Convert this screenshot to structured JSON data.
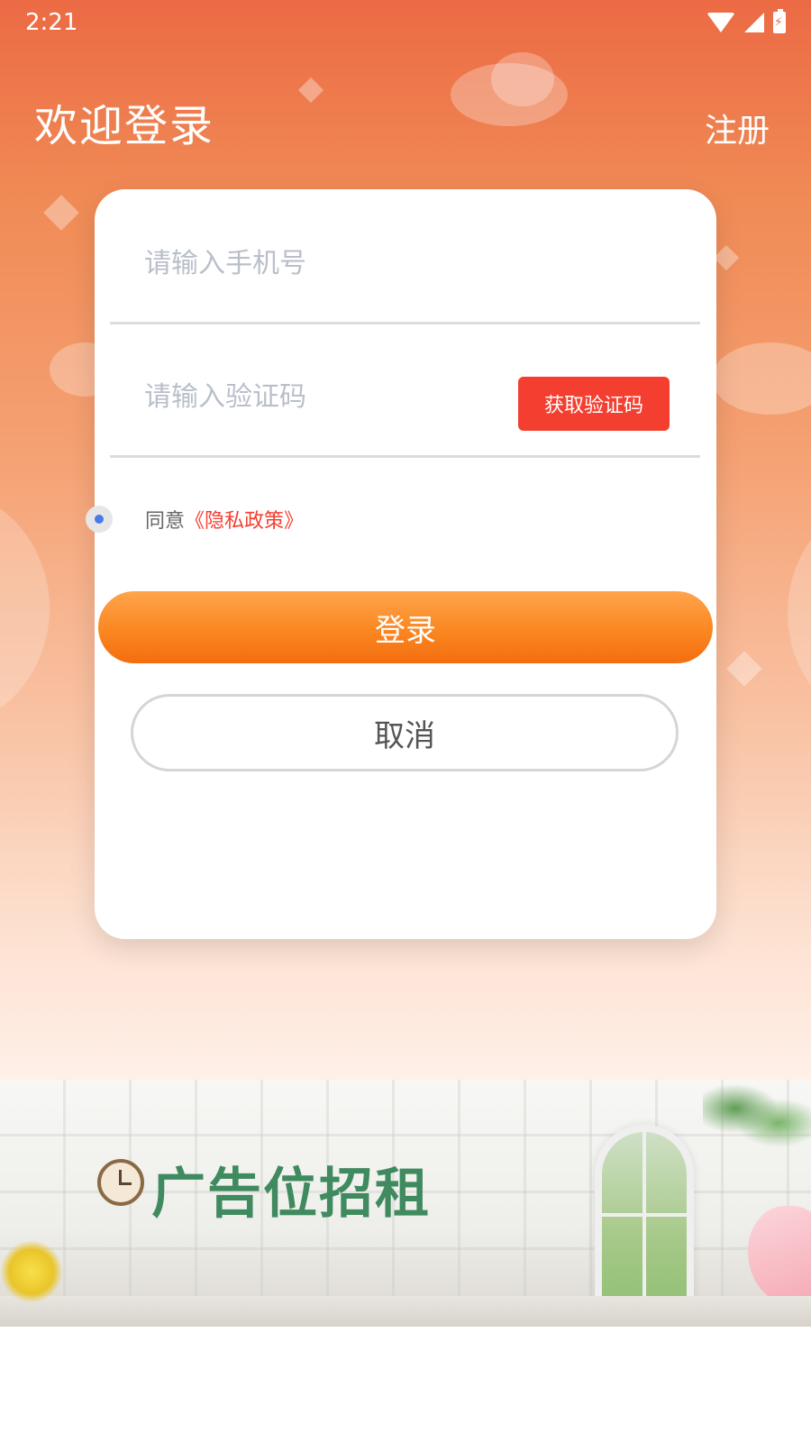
{
  "status_bar": {
    "time": "2:21"
  },
  "header": {
    "title": "欢迎登录",
    "register_label": "注册"
  },
  "form": {
    "phone_placeholder": "请输入手机号",
    "code_placeholder": "请输入验证码",
    "get_code_label": "获取验证码",
    "agree_text": "同意",
    "policy_label": "《隐私政策》",
    "login_label": "登录",
    "cancel_label": "取消"
  },
  "ad": {
    "text": "广告位招租"
  },
  "colors": {
    "accent": "#f43e30",
    "login_gradient": "#fb8a24",
    "header_bg": "#ec6a44"
  }
}
